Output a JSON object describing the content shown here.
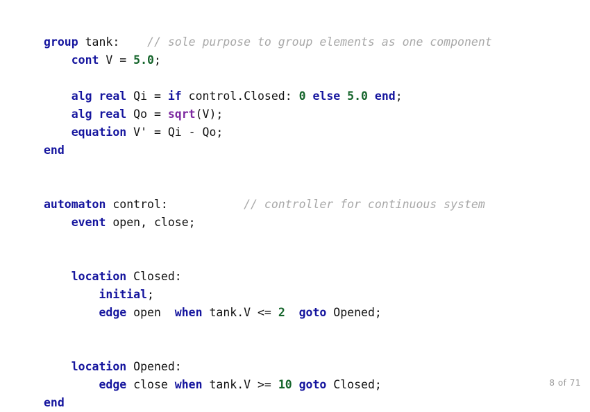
{
  "slide": {
    "background_color": "#ffffff",
    "page_label": "8 of 71"
  },
  "syntax_colors": {
    "keyword": "#15159e",
    "number": "#15652b",
    "function": "#7d2aa0",
    "identifier": "#111111",
    "comment": "#a8a8a8",
    "background": "#ffffff"
  },
  "code": {
    "language": "CIF",
    "lines": [
      {
        "id": "line-1",
        "tokens": [
          {
            "t": "group",
            "c": "kw"
          },
          {
            "t": " tank:",
            "c": "id"
          },
          {
            "t": "    ",
            "c": "op"
          },
          {
            "t": "// sole purpose to group elements as one component",
            "c": "cmt"
          }
        ]
      },
      {
        "id": "line-2",
        "tokens": [
          {
            "t": "    ",
            "c": "op"
          },
          {
            "t": "cont",
            "c": "kw"
          },
          {
            "t": " V = ",
            "c": "id"
          },
          {
            "t": "5.0",
            "c": "num"
          },
          {
            "t": ";",
            "c": "id"
          }
        ]
      },
      {
        "id": "line-3",
        "tokens": [
          {
            "t": "",
            "c": "id"
          }
        ]
      },
      {
        "id": "line-4",
        "tokens": [
          {
            "t": "    ",
            "c": "op"
          },
          {
            "t": "alg real",
            "c": "kw"
          },
          {
            "t": " Qi = ",
            "c": "id"
          },
          {
            "t": "if",
            "c": "kw"
          },
          {
            "t": " control.Closed: ",
            "c": "id"
          },
          {
            "t": "0",
            "c": "num"
          },
          {
            "t": " ",
            "c": "id"
          },
          {
            "t": "else",
            "c": "kw"
          },
          {
            "t": " ",
            "c": "id"
          },
          {
            "t": "5.0",
            "c": "num"
          },
          {
            "t": " ",
            "c": "id"
          },
          {
            "t": "end",
            "c": "kw"
          },
          {
            "t": ";",
            "c": "id"
          }
        ]
      },
      {
        "id": "line-5",
        "tokens": [
          {
            "t": "    ",
            "c": "op"
          },
          {
            "t": "alg real",
            "c": "kw"
          },
          {
            "t": " Qo = ",
            "c": "id"
          },
          {
            "t": "sqrt",
            "c": "fn"
          },
          {
            "t": "(V);",
            "c": "id"
          }
        ]
      },
      {
        "id": "line-6",
        "tokens": [
          {
            "t": "    ",
            "c": "op"
          },
          {
            "t": "equation",
            "c": "kw"
          },
          {
            "t": " V' = Qi ",
            "c": "id"
          },
          {
            "t": "-",
            "c": "op"
          },
          {
            "t": " Qo;",
            "c": "id"
          }
        ]
      },
      {
        "id": "line-7",
        "tokens": [
          {
            "t": "end",
            "c": "kw"
          }
        ]
      },
      {
        "id": "line-8",
        "tokens": [
          {
            "t": "",
            "c": "id"
          }
        ]
      },
      {
        "id": "line-9",
        "tokens": [
          {
            "t": "",
            "c": "id"
          }
        ]
      },
      {
        "id": "line-10",
        "tokens": [
          {
            "t": "automaton",
            "c": "kw"
          },
          {
            "t": " control:",
            "c": "id"
          },
          {
            "t": "           ",
            "c": "op"
          },
          {
            "t": "// controller for continuous system",
            "c": "cmt"
          }
        ]
      },
      {
        "id": "line-11",
        "tokens": [
          {
            "t": "    ",
            "c": "op"
          },
          {
            "t": "event",
            "c": "kw"
          },
          {
            "t": " open, close;",
            "c": "id"
          }
        ]
      },
      {
        "id": "line-12",
        "tokens": [
          {
            "t": "",
            "c": "id"
          }
        ]
      },
      {
        "id": "line-13",
        "tokens": [
          {
            "t": "",
            "c": "id"
          }
        ]
      },
      {
        "id": "line-14",
        "tokens": [
          {
            "t": "    ",
            "c": "op"
          },
          {
            "t": "location",
            "c": "kw"
          },
          {
            "t": " Closed:",
            "c": "id"
          }
        ]
      },
      {
        "id": "line-15",
        "tokens": [
          {
            "t": "        ",
            "c": "op"
          },
          {
            "t": "initial",
            "c": "kw"
          },
          {
            "t": ";",
            "c": "id"
          }
        ]
      },
      {
        "id": "line-16",
        "tokens": [
          {
            "t": "        ",
            "c": "op"
          },
          {
            "t": "edge",
            "c": "kw"
          },
          {
            "t": " open  ",
            "c": "id"
          },
          {
            "t": "when",
            "c": "kw"
          },
          {
            "t": " tank.V <= ",
            "c": "id"
          },
          {
            "t": "2",
            "c": "num"
          },
          {
            "t": "  ",
            "c": "id"
          },
          {
            "t": "goto",
            "c": "kw"
          },
          {
            "t": " Opened;",
            "c": "id"
          }
        ]
      },
      {
        "id": "line-17",
        "tokens": [
          {
            "t": "",
            "c": "id"
          }
        ]
      },
      {
        "id": "line-18",
        "tokens": [
          {
            "t": "",
            "c": "id"
          }
        ]
      },
      {
        "id": "line-19",
        "tokens": [
          {
            "t": "    ",
            "c": "op"
          },
          {
            "t": "location",
            "c": "kw"
          },
          {
            "t": " Opened:",
            "c": "id"
          }
        ]
      },
      {
        "id": "line-20",
        "tokens": [
          {
            "t": "        ",
            "c": "op"
          },
          {
            "t": "edge",
            "c": "kw"
          },
          {
            "t": " close ",
            "c": "id"
          },
          {
            "t": "when",
            "c": "kw"
          },
          {
            "t": " tank.V >= ",
            "c": "id"
          },
          {
            "t": "10",
            "c": "num"
          },
          {
            "t": " ",
            "c": "id"
          },
          {
            "t": "goto",
            "c": "kw"
          },
          {
            "t": " Closed;",
            "c": "id"
          }
        ]
      },
      {
        "id": "line-21",
        "tokens": [
          {
            "t": "end",
            "c": "kw"
          }
        ]
      }
    ]
  }
}
